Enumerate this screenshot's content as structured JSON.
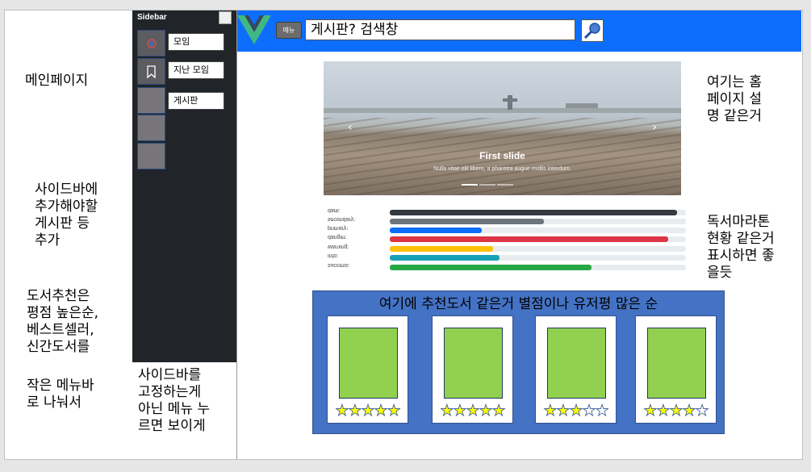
{
  "notes": {
    "main_page": "메인페이지",
    "sidebar_add": "사이드바에\n추가해야할\n게시판 등\n추가",
    "book_rec": "도서추천은\n평점 높은순,\n베스트셀러,\n신간도서를",
    "small_menu": "작은 메뉴바\n로 나눠서",
    "sidebar_fixed": "사이드바를\n고정하는게\n아닌 메뉴 누\n르면 보이게",
    "home_desc": "여기는 홈\n페이지 설\n명 같은거",
    "reading_marathon": "독서마라톤\n현황 같은거\n표시하면 좋\n을듯"
  },
  "sidebar": {
    "title": "Sidebar",
    "items": [
      {
        "label": "모임",
        "icon": "meeting-icon"
      },
      {
        "label": "지난 모임",
        "icon": "bookmark-icon"
      },
      {
        "label": "게시판",
        "icon": "board-icon"
      },
      {
        "label": "",
        "icon": "blank-icon"
      },
      {
        "label": "",
        "icon": "blank-icon"
      }
    ]
  },
  "header": {
    "menu_label": "메뉴",
    "search_value": "게시판?  검색창",
    "colors": {
      "bar": "#0d6efd",
      "logo_green": "#41b883",
      "logo_dark": "#34495e"
    }
  },
  "carousel": {
    "title": "First slide",
    "text": "Nulla vitae elit libero, a pharetra augue mollis interdum."
  },
  "progress": [
    {
      "label": "dark:",
      "value": 97,
      "color": "#343a40"
    },
    {
      "label": "secondary:",
      "value": 52,
      "color": "#6c757d"
    },
    {
      "label": "primary:",
      "value": 31,
      "color": "#0d6efd"
    },
    {
      "label": "danger:",
      "value": 94,
      "color": "#dc3545"
    },
    {
      "label": "warning:",
      "value": 35,
      "color": "#ffc107"
    },
    {
      "label": "info:",
      "value": 37,
      "color": "#17a2b8"
    },
    {
      "label": "success:",
      "value": 68,
      "color": "#28a745"
    }
  ],
  "recommend": {
    "title": "여기에 추천도서 같은거 별점이나 유저평 많은 순",
    "cards": [
      {
        "rating": 5
      },
      {
        "rating": 5
      },
      {
        "rating": 3
      },
      {
        "rating": 4
      }
    ]
  }
}
